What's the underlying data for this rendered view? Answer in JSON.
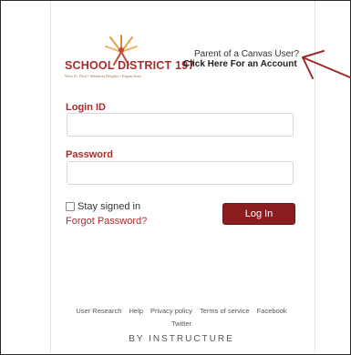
{
  "logo": {
    "name": "SCHOOL DISTRICT 197",
    "tagline": "West St. Paul • Mendota Heights • Eagan Area"
  },
  "parent": {
    "question": "Parent of a Canvas User?",
    "link": "Click Here For an Account"
  },
  "form": {
    "login_id_label": "Login ID",
    "login_id_value": "",
    "password_label": "Password",
    "password_value": "",
    "stay_signed_in": "Stay signed in",
    "forgot_password": "Forgot Password?",
    "login_button": "Log In"
  },
  "footer": {
    "links": [
      "User Research",
      "Help",
      "Privacy policy",
      "Terms of service",
      "Facebook",
      "Twitter"
    ],
    "brand": "BY INSTRUCTURE"
  },
  "colors": {
    "brand": "#a92b2b",
    "button": "#8b1d1f",
    "annotation_arrow": "#9b2a2a"
  },
  "icons": {
    "logo_mark": "star-figure-icon",
    "annotation": "arrow-icon"
  }
}
